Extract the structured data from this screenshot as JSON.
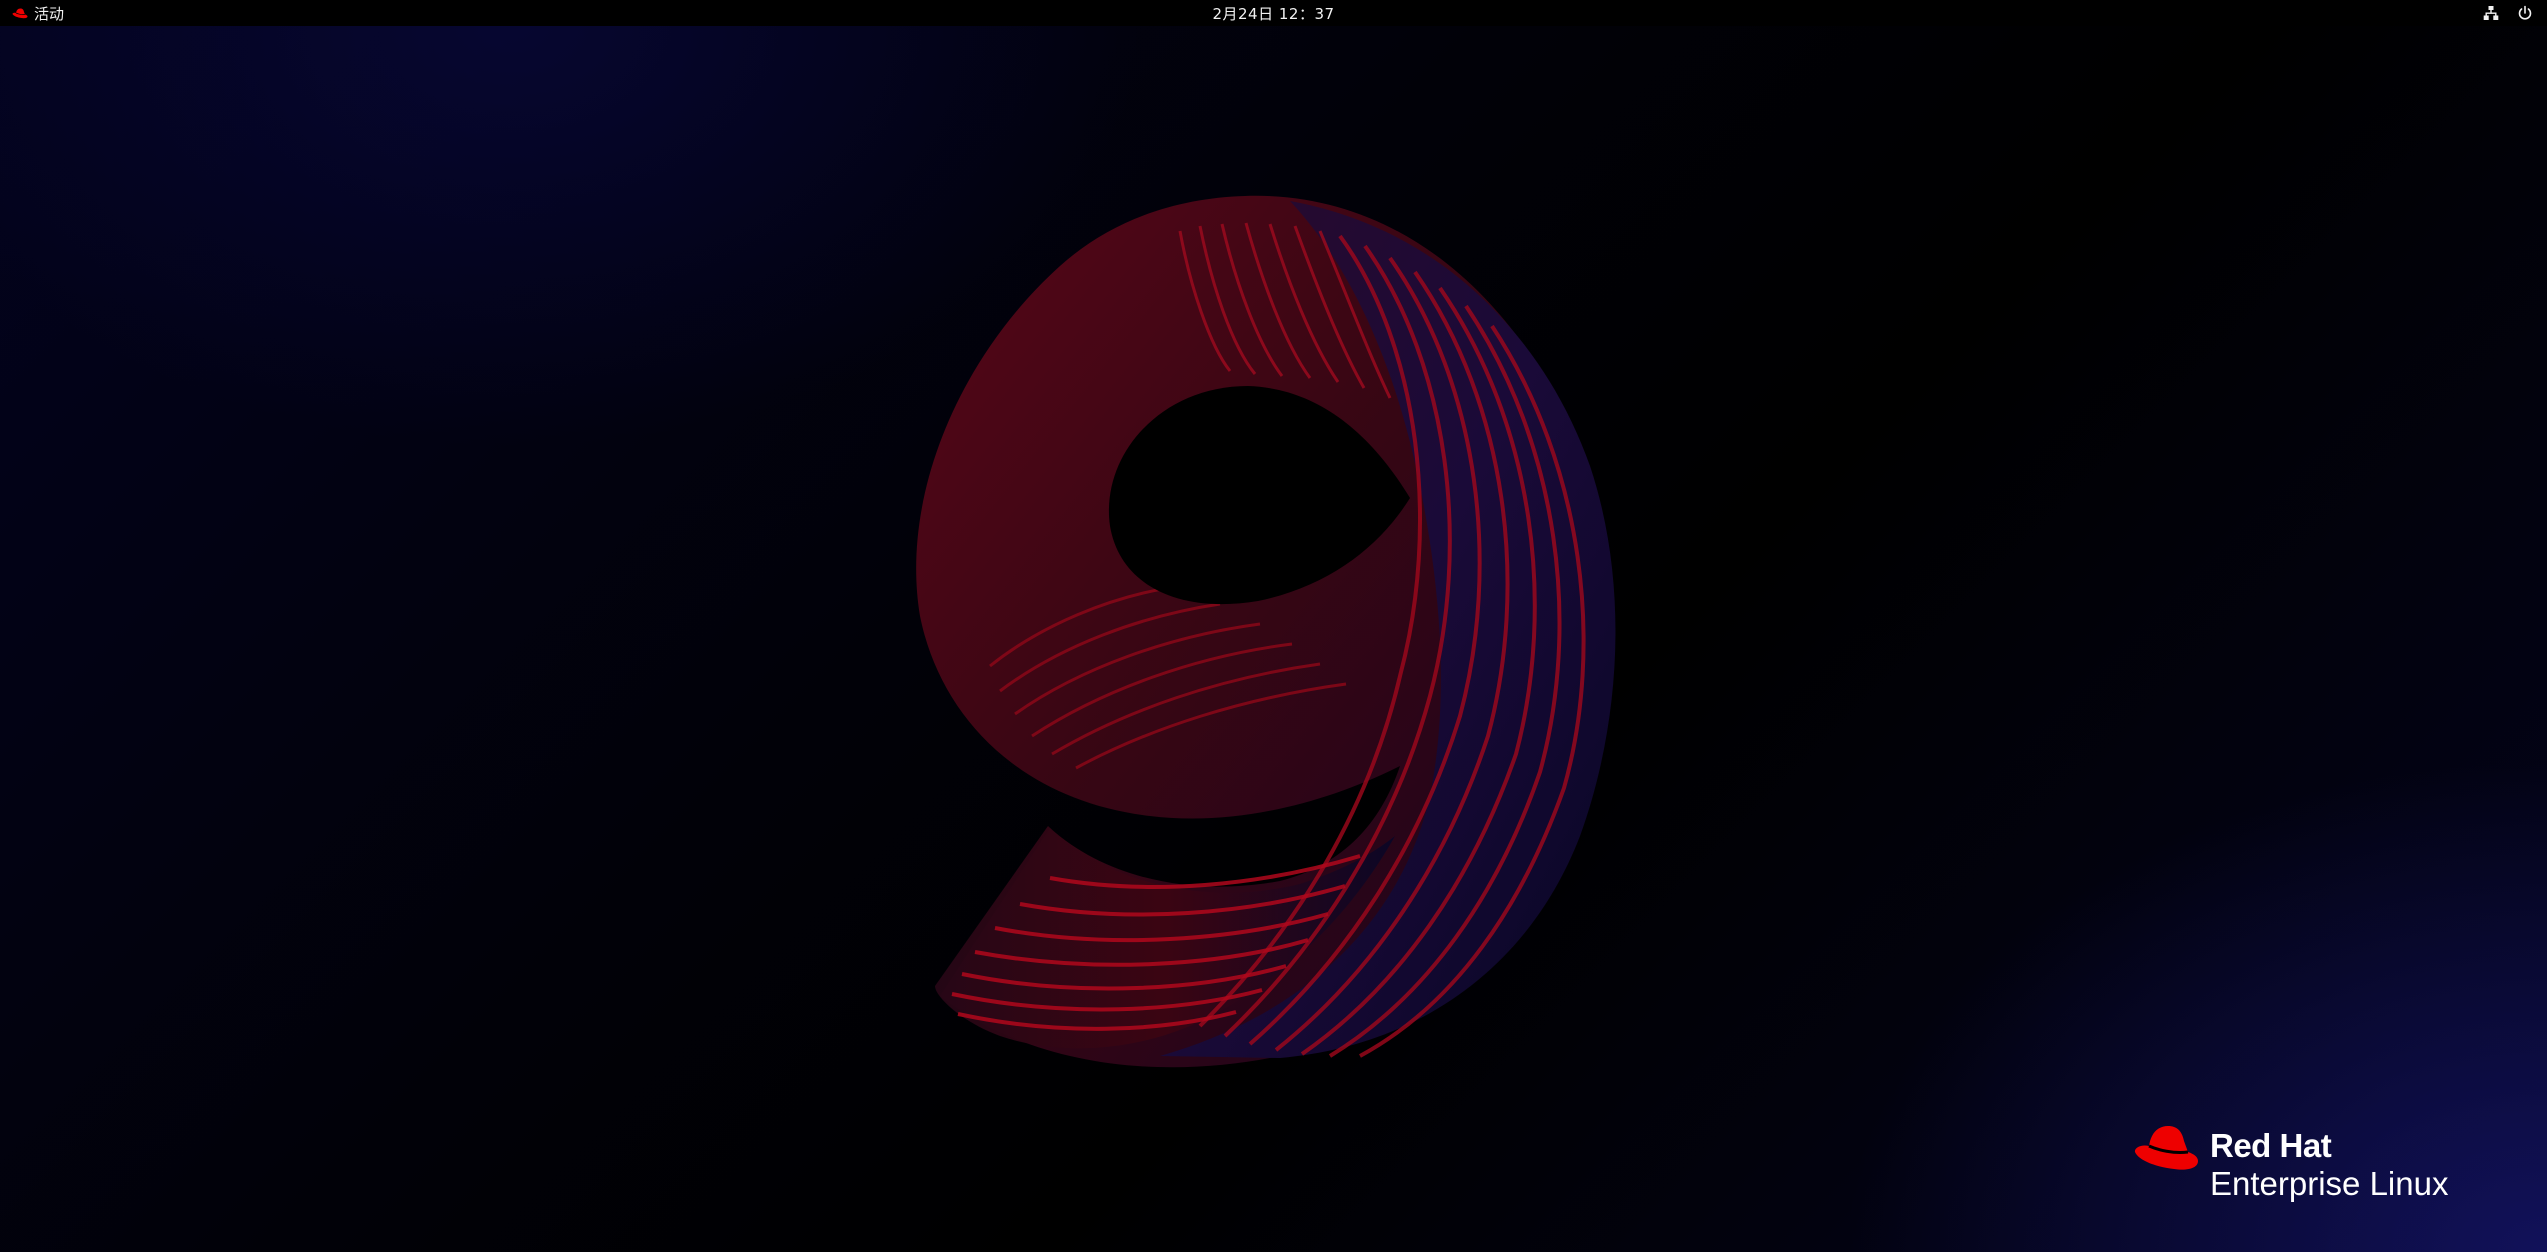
{
  "topbar": {
    "activities_label": "活动",
    "clock": "2月24日 12：37",
    "tray_icons": [
      "network-wired-icon",
      "power-icon"
    ]
  },
  "wallpaper": {
    "numeral": "9",
    "colors": {
      "red": "#8a0a1c",
      "crimson": "#c0081a",
      "violet": "#3a1848",
      "navy": "#07062a"
    }
  },
  "brand": {
    "line1": "Red Hat",
    "line2": "Enterprise Linux",
    "accent": "#ee0000"
  }
}
